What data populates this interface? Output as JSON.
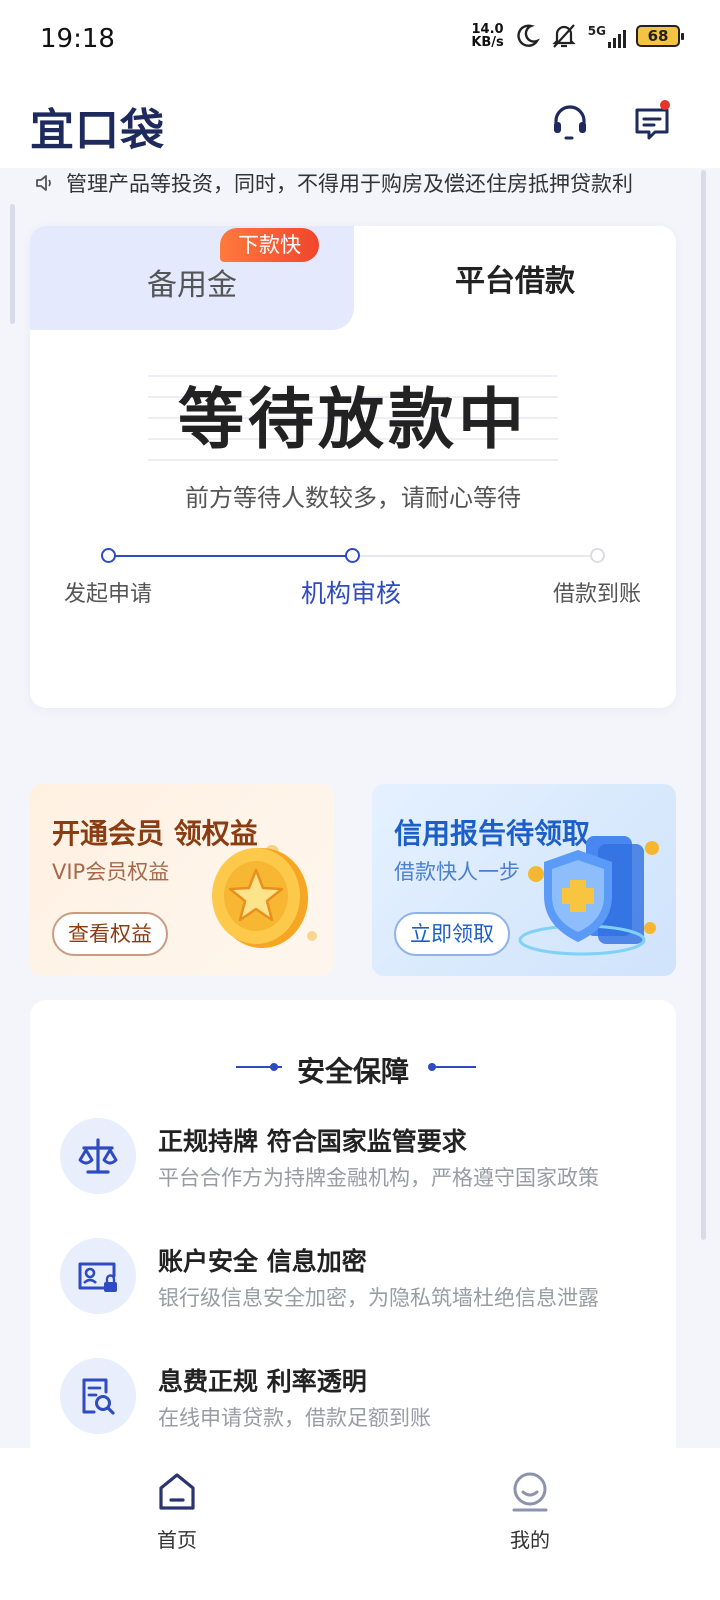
{
  "status_bar": {
    "time": "19:18",
    "net_speed_value": "14.0",
    "net_speed_unit": "KB/s",
    "signal": "5G",
    "battery": "68"
  },
  "header": {
    "logo": "宜口袋",
    "support_icon": "headset-icon",
    "message_icon": "message-icon"
  },
  "notice": {
    "text": "管理产品等投资，同时，不得用于购房及偿还住房抵押贷款利",
    "icon": "speaker-icon"
  },
  "loan_card": {
    "tabs": [
      {
        "label": "备用金",
        "active": false
      },
      {
        "label": "平台借款",
        "active": true
      }
    ],
    "badge": "下款快",
    "status_title": "等待放款中",
    "status_subtitle": "前方等待人数较多，请耐心等待",
    "steps": [
      {
        "label": "发起申请",
        "state": "done"
      },
      {
        "label": "机构审核",
        "state": "current"
      },
      {
        "label": "借款到账",
        "state": "pending"
      }
    ],
    "accent_color": "#2f4bc2"
  },
  "promos": [
    {
      "title": "开通会员 领权益",
      "subtitle": "VIP会员权益",
      "button": "查看权益",
      "art": "gold-star-coin"
    },
    {
      "title": "信用报告待领取",
      "subtitle": "借款快人一步",
      "button": "立即领取",
      "art": "blue-shield"
    }
  ],
  "security": {
    "title": "安全保障",
    "items": [
      {
        "title": "正规持牌 符合国家监管要求",
        "desc": "平台合作方为持牌金融机构，严格遵守国家政策",
        "icon": "scale-icon"
      },
      {
        "title": "账户安全 信息加密",
        "desc": "银行级信息安全加密，为隐私筑墙杜绝信息泄露",
        "icon": "id-card-lock-icon"
      },
      {
        "title": "息费正规  利率透明",
        "desc": "在线申请贷款，借款足额到账",
        "icon": "document-search-icon"
      }
    ]
  },
  "bottom_nav": [
    {
      "label": "首页",
      "icon": "home-icon",
      "active": true
    },
    {
      "label": "我的",
      "icon": "profile-icon",
      "active": false
    }
  ]
}
